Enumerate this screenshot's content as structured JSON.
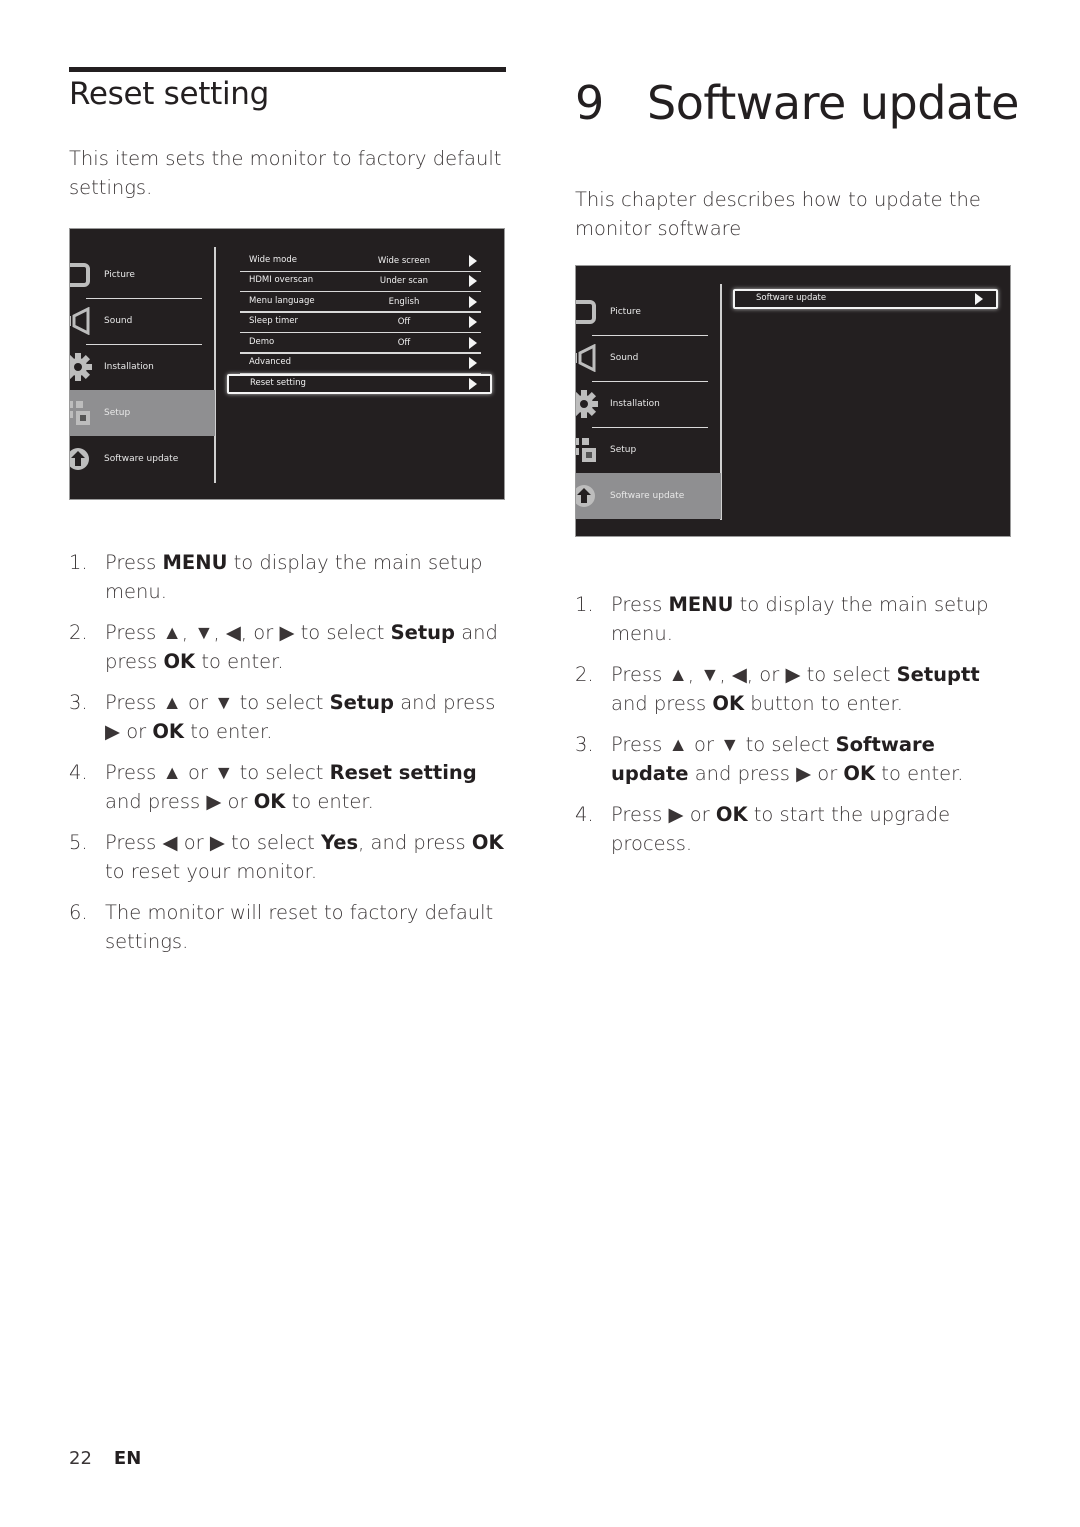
{
  "left": {
    "section_title": "Reset setting",
    "intro": "This item sets the monitor to factory default settings.",
    "osd": {
      "categories": [
        {
          "label": "Picture",
          "icon": "picture-icon",
          "active": false
        },
        {
          "label": "Sound",
          "icon": "sound-icon",
          "active": false
        },
        {
          "label": "Installation",
          "icon": "gear-icon",
          "active": false
        },
        {
          "label": "Setup",
          "icon": "setup-icon",
          "active": true
        },
        {
          "label": "Software update",
          "icon": "upload-icon",
          "active": false
        }
      ],
      "rows": [
        {
          "label": "Wide mode",
          "value": "Wide screen",
          "selected": false
        },
        {
          "label": "HDMI overscan",
          "value": "Under scan",
          "selected": false
        },
        {
          "label": "Menu language",
          "value": "English",
          "selected": false
        },
        {
          "label": "Sleep timer",
          "value": "Off",
          "selected": false
        },
        {
          "label": "Demo",
          "value": "Off",
          "selected": false
        },
        {
          "label": "Advanced",
          "value": "",
          "selected": false
        },
        {
          "label": "Reset setting",
          "value": "",
          "selected": true
        }
      ]
    },
    "steps": [
      {
        "n": "1.",
        "html": "Press <b>MENU</b> to display the main setup menu."
      },
      {
        "n": "2.",
        "html": "Press ▲, ▼, ◀, or ▶ to select <b>Setup</b> and press <b>OK</b> to enter."
      },
      {
        "n": "3.",
        "html": "Press ▲ or ▼ to select <b>Setup</b> and press ▶ or <b>OK</b> to enter."
      },
      {
        "n": "4.",
        "html": "Press ▲ or ▼ to select <b>Reset setting</b> and press ▶ or <b>OK</b> to enter."
      },
      {
        "n": "5.",
        "html": "Press ◀ or ▶ to select <b>Yes</b>, and press <b>OK</b> to reset your monitor."
      },
      {
        "n": "6.",
        "html": "The monitor will reset to factory default settings."
      }
    ]
  },
  "right": {
    "chapter_number": "9",
    "chapter_title": "Software update",
    "intro": "This chapter describes how to update the monitor software",
    "osd": {
      "categories": [
        {
          "label": "Picture",
          "icon": "picture-icon",
          "active": false
        },
        {
          "label": "Sound",
          "icon": "sound-icon",
          "active": false
        },
        {
          "label": "Installation",
          "icon": "gear-icon",
          "active": false
        },
        {
          "label": "Setup",
          "icon": "setup-icon",
          "active": false
        },
        {
          "label": "Software update",
          "icon": "upload-icon",
          "active": true
        }
      ],
      "rows": [
        {
          "label": "Software update",
          "value": "",
          "selected": true
        }
      ]
    },
    "steps": [
      {
        "n": "1.",
        "html": "Press <b>MENU</b> to display the main setup menu."
      },
      {
        "n": "2.",
        "html": "Press ▲, ▼, ◀, or ▶ to select <b>Setuptt</b> and press <b>OK</b> button to enter."
      },
      {
        "n": "3.",
        "html": "Press ▲ or ▼ to select <b>Software update</b> and press ▶ or <b>OK</b> to enter."
      },
      {
        "n": "4.",
        "html": "Press ▶ or <b>OK</b> to start the upgrade process."
      }
    ]
  },
  "footer": {
    "page_number": "22",
    "language": "EN"
  }
}
